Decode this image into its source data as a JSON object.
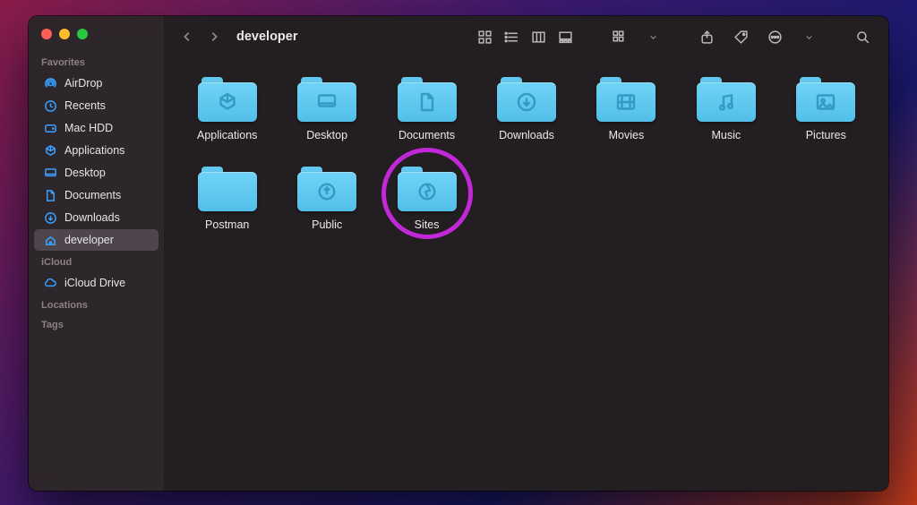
{
  "window": {
    "title": "developer"
  },
  "sidebar": {
    "sections": {
      "favorites": {
        "title": "Favorites",
        "items": [
          {
            "label": "AirDrop",
            "icon": "airdrop"
          },
          {
            "label": "Recents",
            "icon": "clock"
          },
          {
            "label": "Mac HDD",
            "icon": "hdd"
          },
          {
            "label": "Applications",
            "icon": "apps"
          },
          {
            "label": "Desktop",
            "icon": "desktop"
          },
          {
            "label": "Documents",
            "icon": "doc"
          },
          {
            "label": "Downloads",
            "icon": "download"
          },
          {
            "label": "developer",
            "icon": "home",
            "selected": true
          }
        ]
      },
      "icloud": {
        "title": "iCloud",
        "items": [
          {
            "label": "iCloud Drive",
            "icon": "cloud"
          }
        ]
      },
      "locations": {
        "title": "Locations",
        "items": []
      },
      "tags": {
        "title": "Tags",
        "items": []
      }
    }
  },
  "folders": [
    {
      "label": "Applications",
      "glyph": "apps"
    },
    {
      "label": "Desktop",
      "glyph": "desktop"
    },
    {
      "label": "Documents",
      "glyph": "doc"
    },
    {
      "label": "Downloads",
      "glyph": "download"
    },
    {
      "label": "Movies",
      "glyph": "movie"
    },
    {
      "label": "Music",
      "glyph": "music"
    },
    {
      "label": "Pictures",
      "glyph": "picture"
    },
    {
      "label": "Postman",
      "glyph": ""
    },
    {
      "label": "Public",
      "glyph": "public"
    },
    {
      "label": "Sites",
      "glyph": "sites",
      "highlighted": true
    }
  ],
  "accent": "#3aa0ff",
  "folder_color": "#62c8ef",
  "highlight_color": "#c028d8"
}
